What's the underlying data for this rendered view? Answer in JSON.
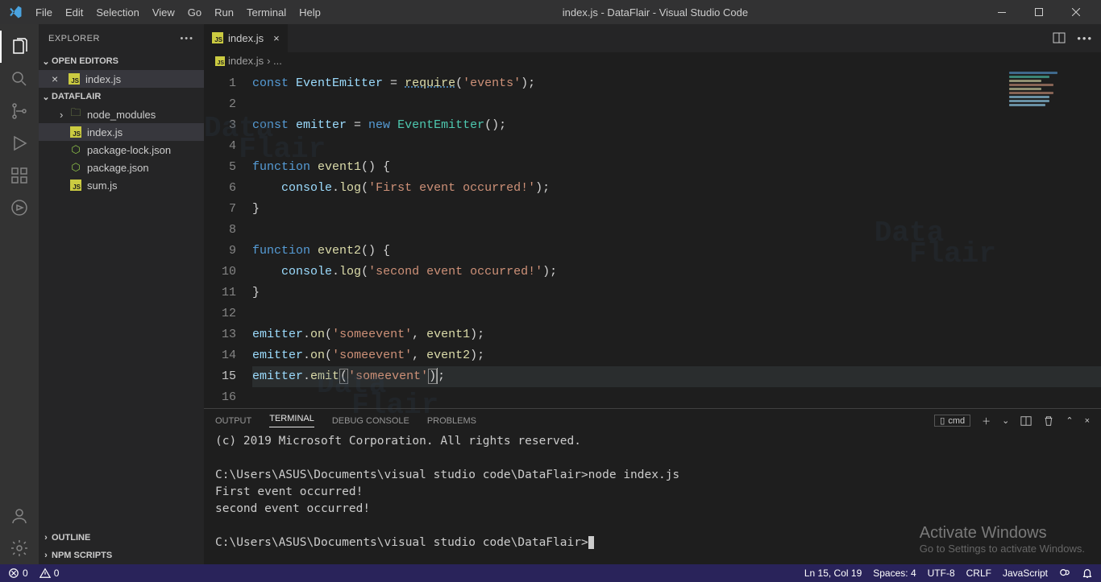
{
  "menu": [
    "File",
    "Edit",
    "Selection",
    "View",
    "Go",
    "Run",
    "Terminal",
    "Help"
  ],
  "window_title": "index.js - DataFlair - Visual Studio Code",
  "explorer": {
    "title": "EXPLORER",
    "open_editors": "OPEN EDITORS",
    "open_file": "index.js",
    "project": "DATAFLAIR",
    "tree": {
      "node_modules": "node_modules",
      "index": "index.js",
      "pkg_lock": "package-lock.json",
      "pkg": "package.json",
      "sum": "sum.js"
    },
    "outline": "OUTLINE",
    "npm_scripts": "NPM SCRIPTS"
  },
  "tab": {
    "label": "index.js"
  },
  "breadcrumb": {
    "file": "index.js",
    "rest": "› ..."
  },
  "code": {
    "l1": {
      "a": "const ",
      "b": "EventEmitter",
      "c": " = ",
      "d": "require",
      "e": "(",
      "f": "'events'",
      "g": ");"
    },
    "l3": {
      "a": "const ",
      "b": "emitter",
      "c": " = ",
      "d": "new ",
      "e": "EventEmitter",
      "f": "();"
    },
    "l5": {
      "a": "function ",
      "b": "event1",
      "c": "() {"
    },
    "l6": {
      "a": "    ",
      "b": "console",
      "c": ".",
      "d": "log",
      "e": "(",
      "f": "'First event occurred!'",
      "g": ");"
    },
    "l7": {
      "a": "}"
    },
    "l9": {
      "a": "function ",
      "b": "event2",
      "c": "() {"
    },
    "l10": {
      "a": "    ",
      "b": "console",
      "c": ".",
      "d": "log",
      "e": "(",
      "f": "'second event occurred!'",
      "g": ");"
    },
    "l11": {
      "a": "}"
    },
    "l13": {
      "a": "emitter",
      "b": ".",
      "c": "on",
      "d": "(",
      "e": "'someevent'",
      "f": ", ",
      "g": "event1",
      "h": ");"
    },
    "l14": {
      "a": "emitter",
      "b": ".",
      "c": "on",
      "d": "(",
      "e": "'someevent'",
      "f": ", ",
      "g": "event2",
      "h": ");"
    },
    "l15": {
      "a": "emitter",
      "b": ".",
      "c": "emit",
      "d": "(",
      "e": "'someevent'",
      "f": ")",
      "g": ";"
    }
  },
  "line_numbers": [
    "1",
    "2",
    "3",
    "4",
    "5",
    "6",
    "7",
    "8",
    "9",
    "10",
    "11",
    "12",
    "13",
    "14",
    "15",
    "16"
  ],
  "panel": {
    "tabs": {
      "output": "OUTPUT",
      "terminal": "TERMINAL",
      "debug": "DEBUG CONSOLE",
      "problems": "PROBLEMS"
    },
    "shell_label": "cmd",
    "content": "(c) 2019 Microsoft Corporation. All rights reserved.\n\nC:\\Users\\ASUS\\Documents\\visual studio code\\DataFlair>node index.js\nFirst event occurred!\nsecond event occurred!\n\nC:\\Users\\ASUS\\Documents\\visual studio code\\DataFlair>"
  },
  "activate": {
    "h": "Activate Windows",
    "s": "Go to Settings to activate Windows."
  },
  "status": {
    "errors": "0",
    "warnings": "0",
    "lncol": "Ln 15, Col 19",
    "spaces": "Spaces: 4",
    "encoding": "UTF-8",
    "eol": "CRLF",
    "lang": "JavaScript"
  }
}
